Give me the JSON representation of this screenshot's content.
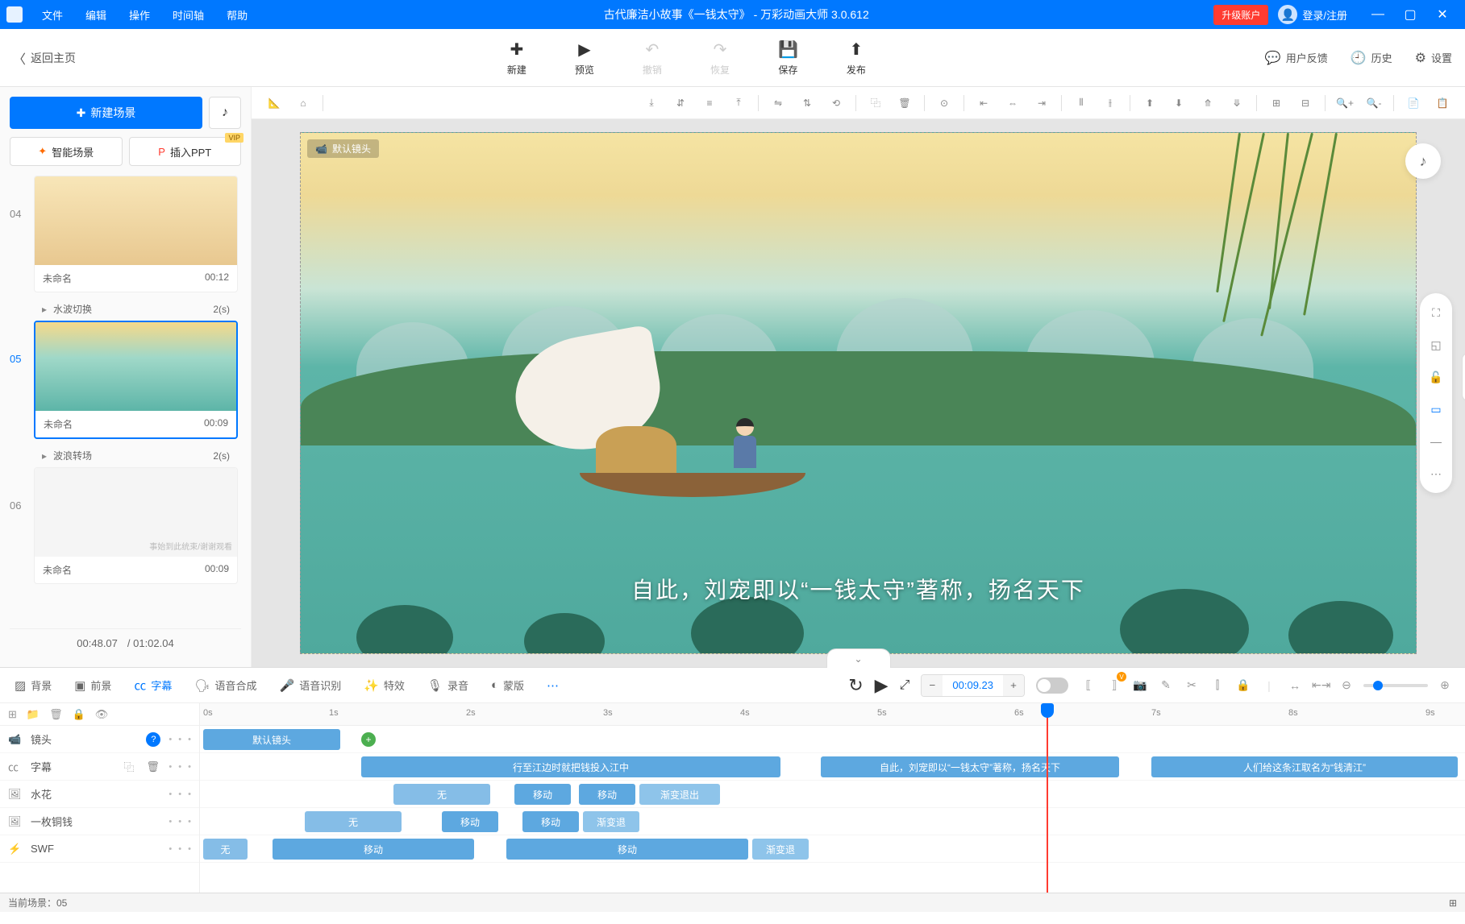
{
  "titlebar": {
    "menus": [
      "文件",
      "编辑",
      "操作",
      "时间轴",
      "帮助"
    ],
    "title": "古代廉洁小故事《一钱太守》 - 万彩动画大师 3.0.612",
    "upgrade": "升级账户",
    "login": "登录/注册"
  },
  "toolbar": {
    "back": "返回主页",
    "new": "新建",
    "preview": "预览",
    "undo": "撤销",
    "redo": "恢复",
    "save": "保存",
    "publish": "发布",
    "feedback": "用户反馈",
    "history": "历史",
    "settings": "设置"
  },
  "sidebar": {
    "new_scene": "新建场景",
    "smart_scene": "智能场景",
    "insert_ppt": "插入PPT",
    "vip": "VIP",
    "scenes": [
      {
        "num": "04",
        "name": "未命名",
        "dur": "00:12",
        "trans": "水波切换",
        "trans_dur": "2(s)"
      },
      {
        "num": "05",
        "name": "未命名",
        "dur": "00:09",
        "trans": "波浪转场",
        "trans_dur": "2(s)"
      },
      {
        "num": "06",
        "name": "未命名",
        "dur": "00:09",
        "thumb_text": "事始到此统束/谢谢观看"
      }
    ],
    "current": "00:48.07",
    "total": "/ 01:02.04"
  },
  "canvas": {
    "cam_label": "默认镜头",
    "subtitle": "自此，刘宠即以“一钱太守”著称，扬名天下"
  },
  "timeline": {
    "tabs": {
      "bg": "背景",
      "fg": "前景",
      "subtitle": "字幕",
      "tts": "语音合成",
      "asr": "语音识别",
      "fx": "特效",
      "record": "录音",
      "mask": "蒙版"
    },
    "time": "00:09.23",
    "ticks": [
      "0s",
      "1s",
      "2s",
      "3s",
      "4s",
      "5s",
      "6s",
      "7s",
      "8s",
      "9s"
    ],
    "tracks": {
      "camera": "镜头",
      "subtitle": "字幕",
      "splash": "水花",
      "coin": "一枚铜钱",
      "swf": "SWF"
    },
    "clips": {
      "cam_default": "默认镜头",
      "sub1": "行至江边时就把钱投入江中",
      "sub2": "自此，刘宠即以“一钱太守”著称，扬名天下",
      "sub3": "人们给这条江取名为“钱清江”",
      "wu": "无",
      "move": "移动",
      "fadeout": "渐变退出",
      "fade": "渐变退"
    }
  },
  "status": {
    "current_scene": "当前场景：05"
  }
}
